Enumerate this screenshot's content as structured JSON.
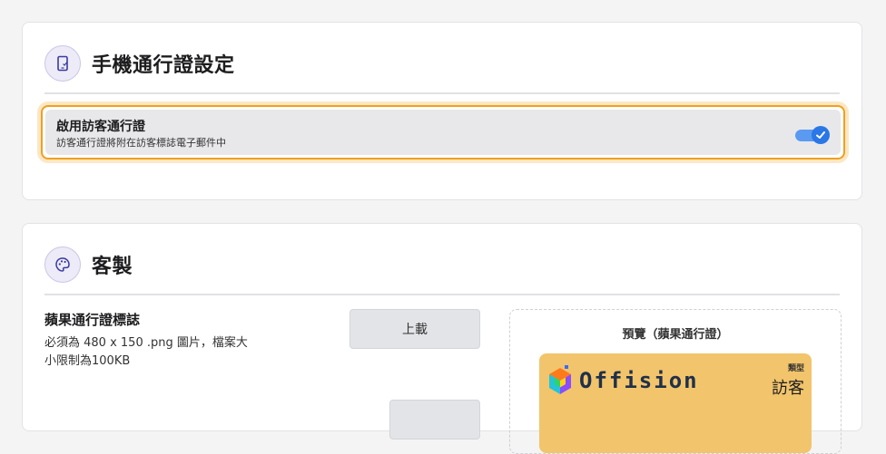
{
  "mobile_pass": {
    "title": "手機通行證設定",
    "icon": "mobile-pass-icon",
    "enable_visitor_pass": {
      "label": "啟用訪客通行證",
      "description": "訪客通行證將附在訪客標誌電子郵件中",
      "enabled": true
    }
  },
  "customize": {
    "title": "客製",
    "icon": "palette-icon",
    "apple_logo": {
      "label": "蘋果通行證標誌",
      "description_line1": "必須為 480 x 150 .png 圖片，檔案大",
      "description_line2": "小限制為100KB",
      "upload_label": "上載"
    },
    "preview": {
      "title": "預覽（蘋果通行證）",
      "logo_text": "Offision",
      "type_label": "類型",
      "type_value": "訪客"
    }
  },
  "colors": {
    "accent": "#2b77e6",
    "highlight_border": "#f0a020",
    "pass_background": "#f2c46b"
  }
}
